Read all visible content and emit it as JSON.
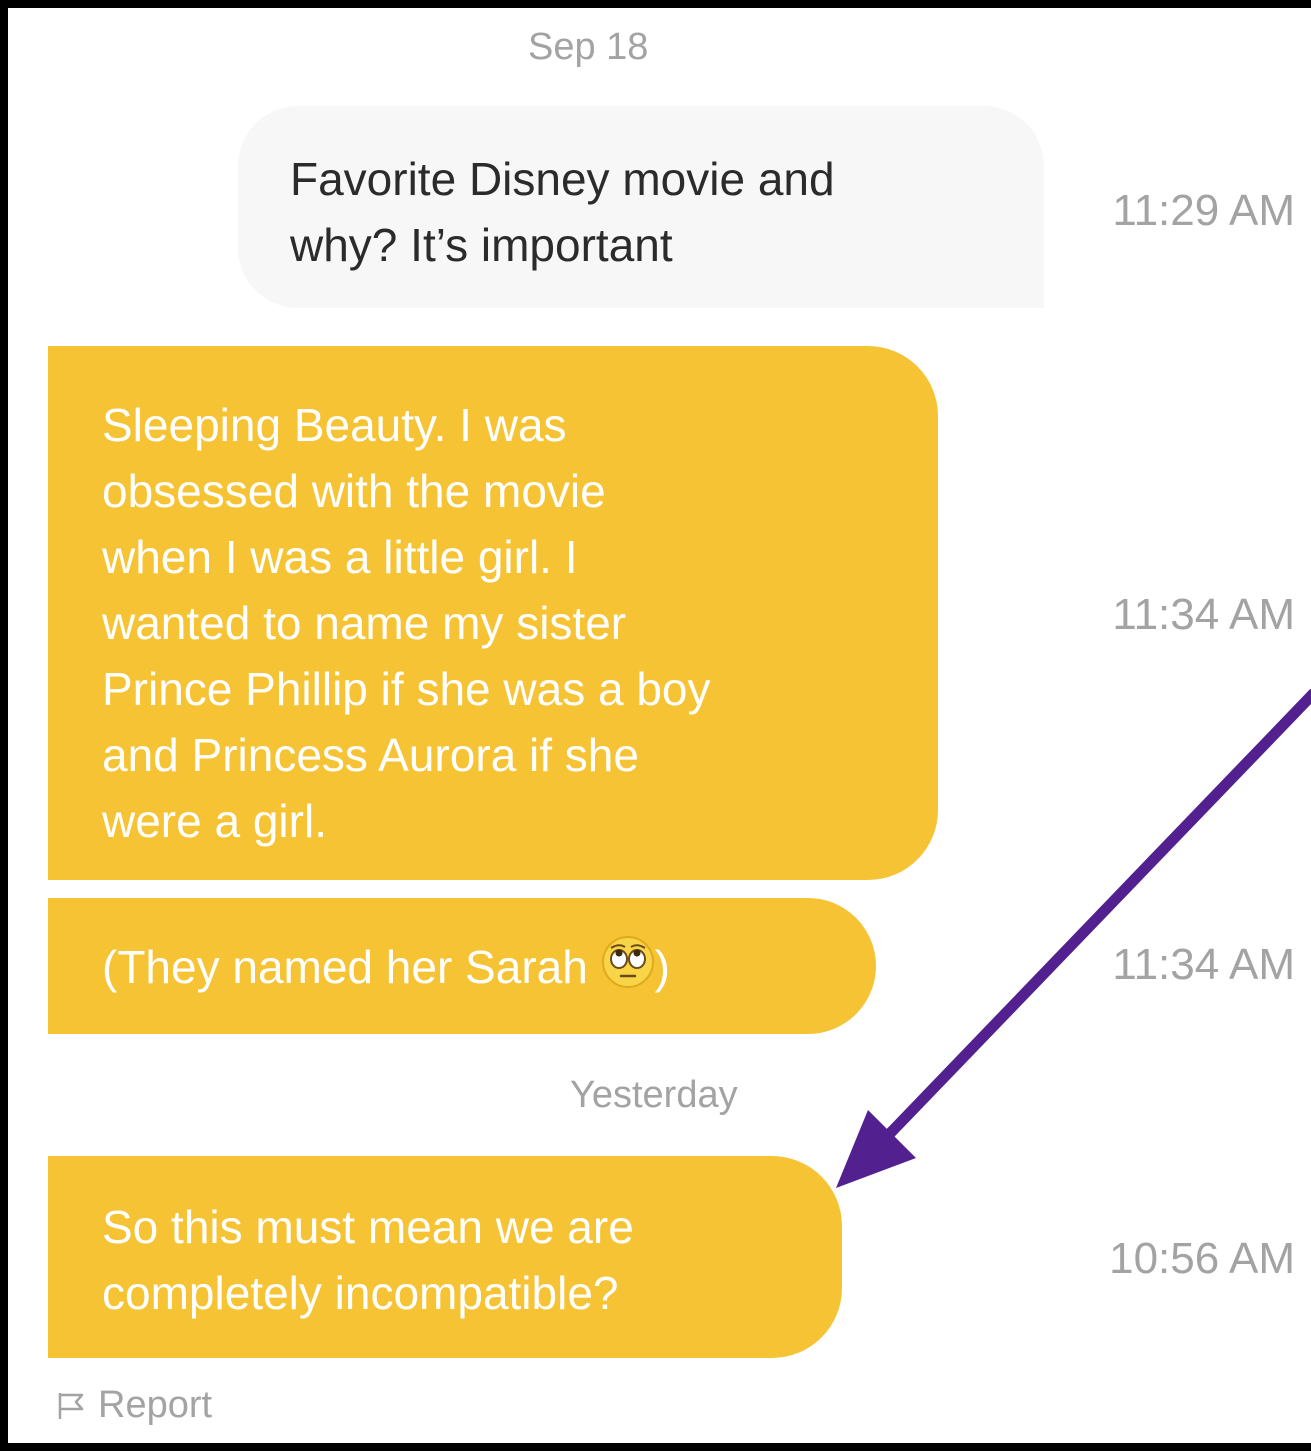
{
  "dates": {
    "first": "Sep 18",
    "second": "Yesterday"
  },
  "messages": [
    {
      "text": "Favorite Disney movie and\nwhy?  It’s important",
      "time": "11:29 AM"
    },
    {
      "text": "Sleeping Beauty.  I was\nobsessed with the movie\nwhen I was a little girl. I\nwanted to name my sister\nPrince Phillip if she was a boy\nand Princess Aurora if she\nwere a girl.",
      "time": "11:34 AM"
    },
    {
      "text_before": "(They named her Sarah ",
      "emoji": "face-with-rolling-eyes-icon",
      "text_after": ")",
      "time": "11:34 AM"
    },
    {
      "text": "So this must mean we are\ncompletely incompatible?",
      "time": "10:56 AM"
    }
  ],
  "report": {
    "label": "Report",
    "icon": "flag-icon"
  },
  "colors": {
    "outgoing_bubble": "#f6c335",
    "incoming_bubble": "#f7f7f7",
    "meta_text": "#a3a3a3",
    "annotation_arrow": "#52208f"
  }
}
